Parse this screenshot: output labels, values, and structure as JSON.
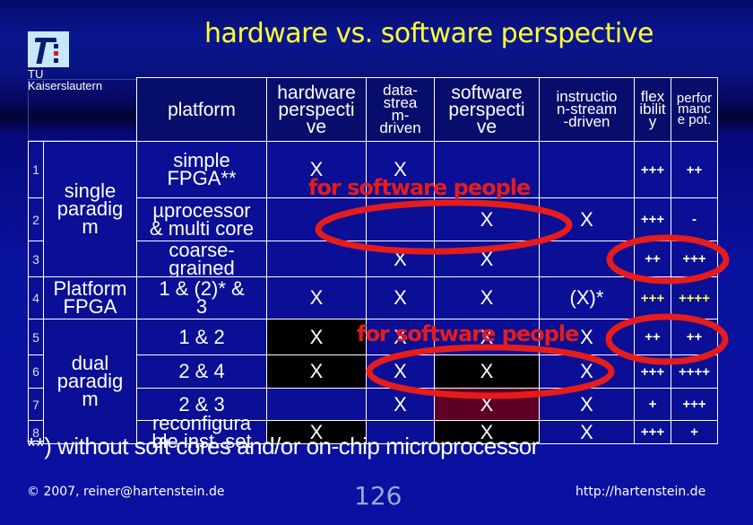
{
  "slide": {
    "title": "hardware vs. software perspective",
    "logo": {
      "icon": "tu-kl-logo-icon",
      "line1": "TU",
      "line2": "Kaiserslautern"
    }
  },
  "table": {
    "headers": [
      "platform",
      "hardware perspective",
      "data-stream-driven",
      "software perspective",
      "instruction-stream-driven",
      "flexibility",
      "performance pot."
    ],
    "header_display": {
      "platform": "platform",
      "hw": [
        "hardware",
        "perspecti",
        "ve"
      ],
      "ds": [
        "data-",
        "strea",
        "m-",
        "driven"
      ],
      "sw": [
        "software",
        "perspecti",
        "ve"
      ],
      "is": [
        "instructio",
        "n-stream",
        "-driven"
      ],
      "flex": [
        "flex",
        "ibilit",
        "y"
      ],
      "perf": [
        "perfor",
        "manc",
        "e pot."
      ]
    },
    "groups": [
      {
        "label": "single paradigm",
        "lines": [
          "single",
          "paradig",
          "m"
        ]
      },
      {
        "label": "Platform FPGA",
        "lines": [
          "Platform",
          "FPGA"
        ]
      },
      {
        "label": "dual paradigm",
        "lines": [
          "dual",
          "paradig",
          "m"
        ]
      }
    ],
    "rows": [
      {
        "n": "1",
        "platform": [
          "simple",
          "FPGA**"
        ],
        "hw": "X",
        "ds": "X",
        "sw": "",
        "is": "",
        "flex": "+++",
        "perf": "++"
      },
      {
        "n": "2",
        "platform": [
          "µprocessor",
          "& multi core"
        ],
        "hw": "",
        "ds": "",
        "sw": "X",
        "is": "X",
        "flex": "+++",
        "perf": "-"
      },
      {
        "n": "3",
        "platform": [
          "coarse-",
          "grained"
        ],
        "hw": "",
        "ds": "X",
        "sw": "X",
        "is": "",
        "flex": "++",
        "perf": "+++"
      },
      {
        "n": "4",
        "platform": [
          "1 & (2)* &",
          "3"
        ],
        "hw": "X",
        "ds": "X",
        "sw": "X",
        "is": "(X)*",
        "flex": "+++",
        "perf": "++++"
      },
      {
        "n": "5",
        "platform": [
          "1 & 2"
        ],
        "hw": "X",
        "ds": "X",
        "sw": "X",
        "is": "X",
        "flex": "++",
        "perf": "++"
      },
      {
        "n": "6",
        "platform": [
          "2 & 4"
        ],
        "hw": "X",
        "ds": "X",
        "sw": "X",
        "is": "X",
        "flex": "+++",
        "perf": "++++"
      },
      {
        "n": "7",
        "platform": [
          "2 & 3"
        ],
        "hw": "",
        "ds": "X",
        "sw": "X",
        "is": "X",
        "flex": "+",
        "perf": "+++"
      },
      {
        "n": "8",
        "platform": [
          "reconfigura",
          "ble inst. set"
        ],
        "hw": "X",
        "ds": "",
        "sw": "X",
        "is": "X",
        "flex": "+++",
        "perf": "+"
      }
    ]
  },
  "annotations": {
    "note1": "for software people",
    "note2": "for software people"
  },
  "footnote": "**) without soft cores and/or on-chip microprocessor",
  "footer": {
    "copyright_symbol": "©",
    "copyright_text": " 2007, reiner@hartenstein.de",
    "page_number": "126",
    "url": "http://hartenstein.de"
  },
  "colors": {
    "title": "#ffff33",
    "annotation": "#e51c1c",
    "highlight_plus": "#ffff55",
    "cell_black": "#000000",
    "cell_maroon": "#5e0026"
  }
}
